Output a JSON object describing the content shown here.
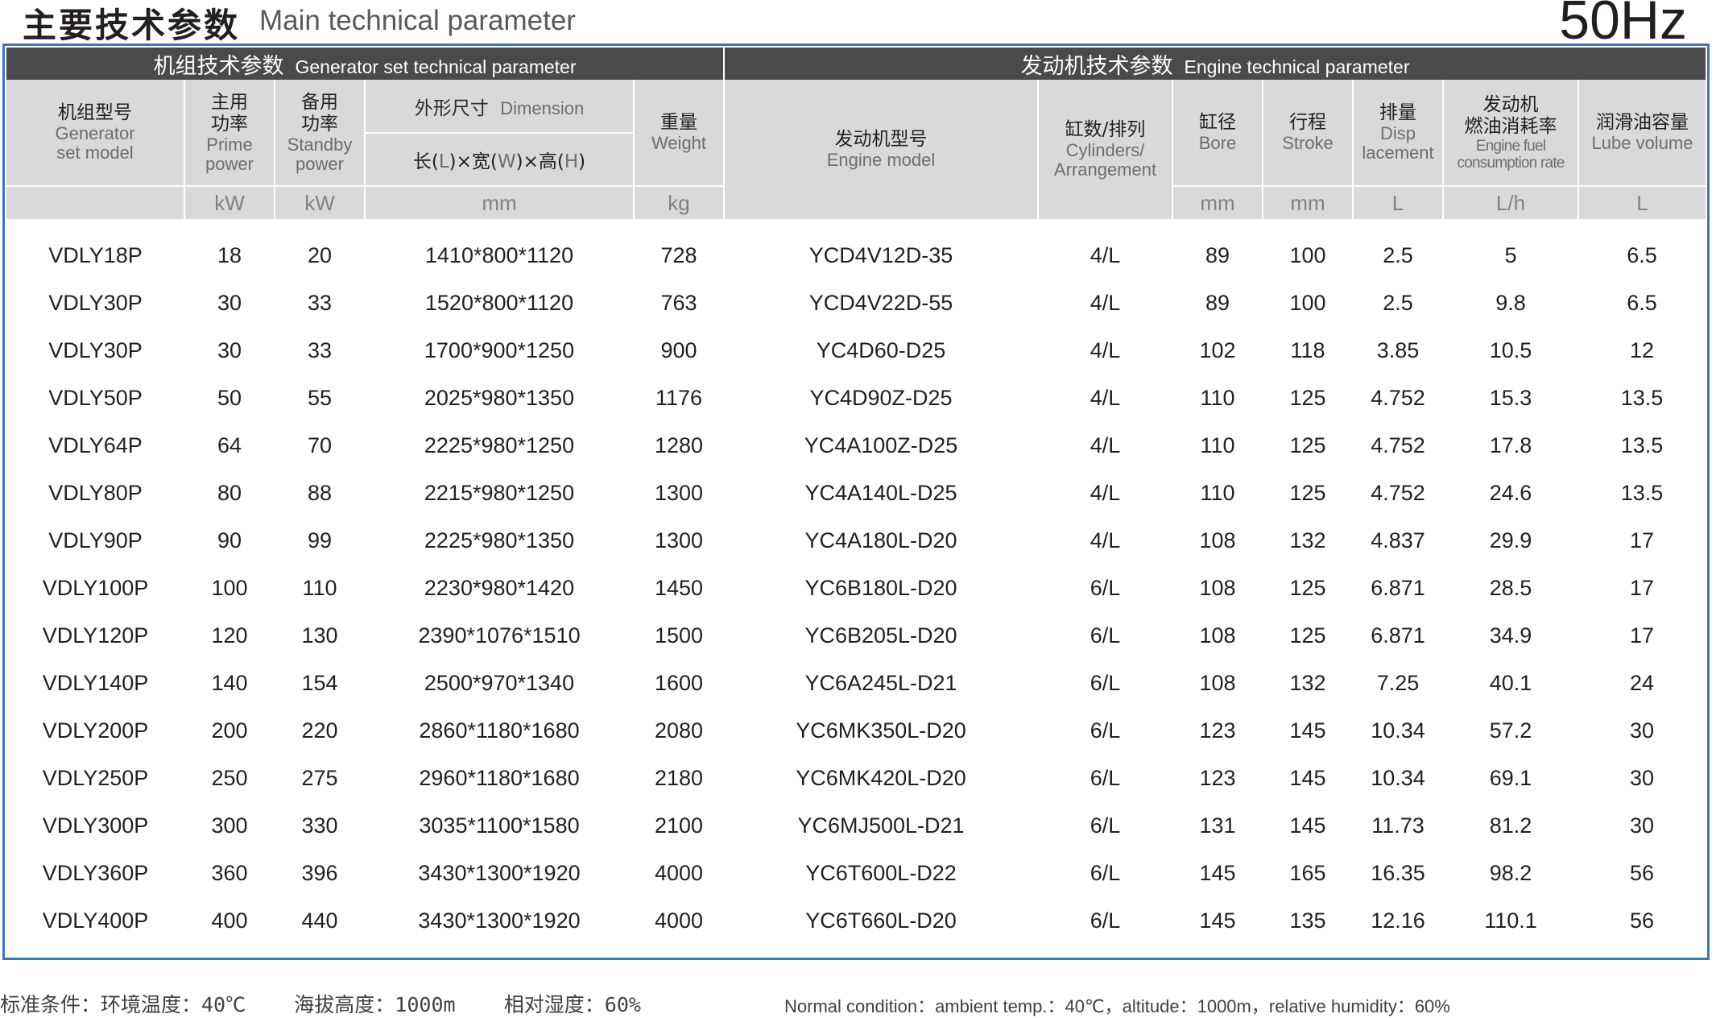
{
  "title": {
    "cn": "主要技术参数",
    "en": "Main technical parameter",
    "frequency": "50Hz"
  },
  "sections": {
    "generator": {
      "cn": "机组技术参数",
      "en": "Generator set technical parameter"
    },
    "engine": {
      "cn": "发动机技术参数",
      "en": "Engine technical parameter"
    }
  },
  "columns": {
    "model": {
      "cn": "机组型号",
      "en1": "Generator",
      "en2": "set model"
    },
    "prime": {
      "cn1": "主用",
      "cn2": "功率",
      "en1": "Prime",
      "en2": "power",
      "unit": "kW"
    },
    "standby": {
      "cn1": "备用",
      "cn2": "功率",
      "en1": "Standby",
      "en2": "power",
      "unit": "kW"
    },
    "dimension": {
      "cn": "外形尺寸",
      "en": "Dimension",
      "sub_l": "长(",
      "L": "L",
      "sub_w": ")×宽(",
      "W": "W",
      "sub_h": ")×高(",
      "H": "H",
      "close": ")",
      "unit": "mm"
    },
    "weight": {
      "cn": "重量",
      "en": "Weight",
      "unit": "kg"
    },
    "engine_model": {
      "cn": "发动机型号",
      "en": "Engine model"
    },
    "cylinders": {
      "cn": "缸数/排列",
      "en1": "Cylinders/",
      "en2": "Arrangement"
    },
    "bore": {
      "cn": "缸径",
      "en": "Bore",
      "unit": "mm"
    },
    "stroke": {
      "cn": "行程",
      "en": "Stroke",
      "unit": "mm"
    },
    "displacement": {
      "cn": "排量",
      "en1": "Disp",
      "en2": "lacement",
      "unit": "L"
    },
    "fuel": {
      "cn1": "发动机",
      "cn2": "燃油消耗率",
      "en1": "Engine fuel",
      "en2": "consumption rate",
      "unit": "L/h"
    },
    "lube": {
      "cn": "润滑油容量",
      "en": "Lube volume",
      "unit": "L"
    }
  },
  "rows": [
    [
      "VDLY18P",
      "18",
      "20",
      "1410*800*1120",
      "728",
      "YCD4V12D-35",
      "4/L",
      "89",
      "100",
      "2.5",
      "5",
      "6.5"
    ],
    [
      "VDLY30P",
      "30",
      "33",
      "1520*800*1120",
      "763",
      "YCD4V22D-55",
      "4/L",
      "89",
      "100",
      "2.5",
      "9.8",
      "6.5"
    ],
    [
      "VDLY30P",
      "30",
      "33",
      "1700*900*1250",
      "900",
      "YC4D60-D25",
      "4/L",
      "102",
      "118",
      "3.85",
      "10.5",
      "12"
    ],
    [
      "VDLY50P",
      "50",
      "55",
      "2025*980*1350",
      "1176",
      "YC4D90Z-D25",
      "4/L",
      "110",
      "125",
      "4.752",
      "15.3",
      "13.5"
    ],
    [
      "VDLY64P",
      "64",
      "70",
      "2225*980*1250",
      "1280",
      "YC4A100Z-D25",
      "4/L",
      "110",
      "125",
      "4.752",
      "17.8",
      "13.5"
    ],
    [
      "VDLY80P",
      "80",
      "88",
      "2215*980*1250",
      "1300",
      "YC4A140L-D25",
      "4/L",
      "110",
      "125",
      "4.752",
      "24.6",
      "13.5"
    ],
    [
      "VDLY90P",
      "90",
      "99",
      "2225*980*1350",
      "1300",
      "YC4A180L-D20",
      "4/L",
      "108",
      "132",
      "4.837",
      "29.9",
      "17"
    ],
    [
      "VDLY100P",
      "100",
      "110",
      "2230*980*1420",
      "1450",
      "YC6B180L-D20",
      "6/L",
      "108",
      "125",
      "6.871",
      "28.5",
      "17"
    ],
    [
      "VDLY120P",
      "120",
      "130",
      "2390*1076*1510",
      "1500",
      "YC6B205L-D20",
      "6/L",
      "108",
      "125",
      "6.871",
      "34.9",
      "17"
    ],
    [
      "VDLY140P",
      "140",
      "154",
      "2500*970*1340",
      "1600",
      "YC6A245L-D21",
      "6/L",
      "108",
      "132",
      "7.25",
      "40.1",
      "24"
    ],
    [
      "VDLY200P",
      "200",
      "220",
      "2860*1180*1680",
      "2080",
      "YC6MK350L-D20",
      "6/L",
      "123",
      "145",
      "10.34",
      "57.2",
      "30"
    ],
    [
      "VDLY250P",
      "250",
      "275",
      "2960*1180*1680",
      "2180",
      "YC6MK420L-D20",
      "6/L",
      "123",
      "145",
      "10.34",
      "69.1",
      "30"
    ],
    [
      "VDLY300P",
      "300",
      "330",
      "3035*1100*1580",
      "2100",
      "YC6MJ500L-D21",
      "6/L",
      "131",
      "145",
      "11.73",
      "81.2",
      "30"
    ],
    [
      "VDLY360P",
      "360",
      "396",
      "3430*1300*1920",
      "4000",
      "YC6T600L-D22",
      "6/L",
      "145",
      "165",
      "16.35",
      "98.2",
      "56"
    ],
    [
      "VDLY400P",
      "400",
      "440",
      "3430*1300*1920",
      "4000",
      "YC6T660L-D20",
      "6/L",
      "145",
      "135",
      "12.16",
      "110.1",
      "56"
    ]
  ],
  "footer": {
    "cn": "标准条件：环境温度：40℃    海拔高度：1000m    相对湿度：60%",
    "en": "Normal condition：ambient temp.：40℃，altitude：1000m，relative humidity：60%"
  }
}
